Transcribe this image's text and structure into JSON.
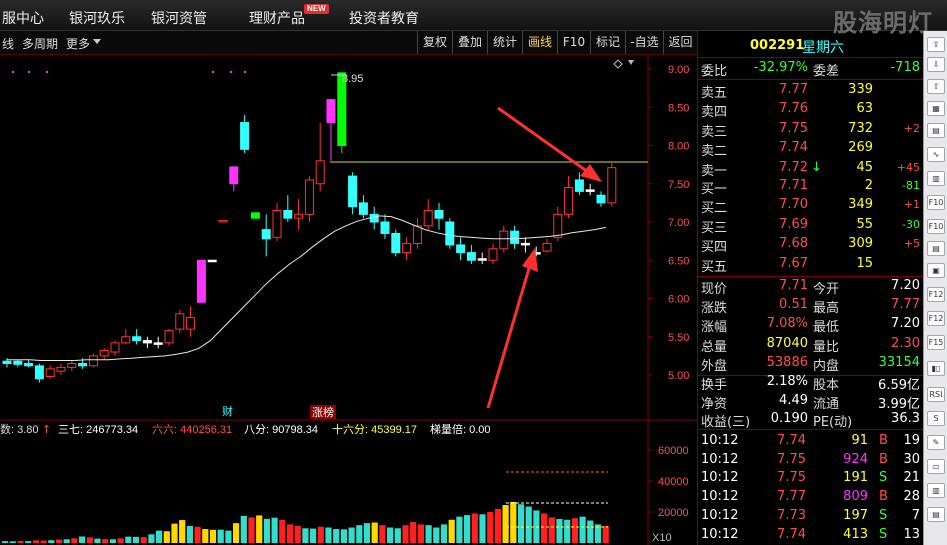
{
  "menu": {
    "items": [
      "服中心",
      "银河玖乐",
      "银河资管",
      "理财产品",
      "投资者教育"
    ],
    "new_badge": "NEW",
    "logo": "股海明灯"
  },
  "toolbar": {
    "left": [
      "线",
      "多周期",
      "更多"
    ],
    "buttons": [
      "复权",
      "叠加",
      "统计",
      "画线",
      "F10",
      "标记",
      "-自选",
      "返回"
    ],
    "active": "画线"
  },
  "quote": {
    "code": "002291",
    "name": "星期六",
    "weibi_label": "委比",
    "weibi": "-32.97%",
    "weicha_label": "委差",
    "weicha": "-718",
    "asks": [
      {
        "label": "卖五",
        "price": "7.77",
        "vol": "339",
        "chg": ""
      },
      {
        "label": "卖四",
        "price": "7.76",
        "vol": "63",
        "chg": ""
      },
      {
        "label": "卖三",
        "price": "7.75",
        "vol": "732",
        "chg": "+2"
      },
      {
        "label": "卖二",
        "price": "7.74",
        "vol": "269",
        "chg": ""
      },
      {
        "label": "卖一",
        "price": "7.72",
        "vol": "45",
        "chg": "+45",
        "arrow": "↓"
      }
    ],
    "bids": [
      {
        "label": "买一",
        "price": "7.71",
        "vol": "2",
        "chg": "-81"
      },
      {
        "label": "买二",
        "price": "7.70",
        "vol": "349",
        "chg": "+1"
      },
      {
        "label": "买三",
        "price": "7.69",
        "vol": "55",
        "chg": "-30"
      },
      {
        "label": "买四",
        "price": "7.68",
        "vol": "309",
        "chg": "+5"
      },
      {
        "label": "买五",
        "price": "7.67",
        "vol": "15",
        "chg": ""
      }
    ],
    "stats": [
      {
        "l1": "现价",
        "v1": "7.71",
        "c1": "red",
        "l2": "今开",
        "v2": "7.20",
        "c2": "wht"
      },
      {
        "l1": "涨跌",
        "v1": "0.51",
        "c1": "red",
        "l2": "最高",
        "v2": "7.77",
        "c2": "red"
      },
      {
        "l1": "涨幅",
        "v1": "7.08%",
        "c1": "red",
        "l2": "最低",
        "v2": "7.20",
        "c2": "wht"
      },
      {
        "l1": "总量",
        "v1": "87040",
        "c1": "yel",
        "l2": "量比",
        "v2": "2.30",
        "c2": "red"
      },
      {
        "l1": "外盘",
        "v1": "53886",
        "c1": "red",
        "l2": "内盘",
        "v2": "33154",
        "c2": "grn"
      }
    ],
    "stats2": [
      {
        "l1": "换手",
        "v1": "2.18%",
        "l2": "股本",
        "v2": "6.59亿"
      },
      {
        "l1": "净资",
        "v1": "4.49",
        "l2": "流通",
        "v2": "3.99亿"
      },
      {
        "l1": "收益(三)",
        "v1": "0.190",
        "l2": "PE(动)",
        "v2": "36.3"
      }
    ],
    "ticks": [
      {
        "time": "10:12",
        "price": "7.74",
        "vol": "91",
        "vc": "yel",
        "bs": "B",
        "n": "19"
      },
      {
        "time": "10:12",
        "price": "7.75",
        "vol": "924",
        "vc": "mag",
        "bs": "B",
        "n": "30"
      },
      {
        "time": "10:12",
        "price": "7.75",
        "vol": "191",
        "vc": "yel",
        "bs": "S",
        "n": "21"
      },
      {
        "time": "10:12",
        "price": "7.77",
        "vol": "809",
        "vc": "mag",
        "bs": "B",
        "n": "28"
      },
      {
        "time": "10:12",
        "price": "7.73",
        "vol": "197",
        "vc": "yel",
        "bs": "S",
        "n": "7"
      },
      {
        "time": "10:12",
        "price": "7.74",
        "vol": "413",
        "vc": "yel",
        "bs": "S",
        "n": "13"
      }
    ]
  },
  "chart_data": [
    {
      "type": "candlestick",
      "y_ticks": [
        "9.00",
        "8.50",
        "8.00",
        "7.50",
        "7.00",
        "6.50",
        "6.00",
        "5.50",
        "5.00"
      ],
      "ylim": [
        4.85,
        9.1
      ],
      "high_annotation": "8.95",
      "annotations": [
        "财",
        "涨榜"
      ],
      "ma_line": [
        5.2,
        5.2,
        5.2,
        5.19,
        5.19,
        5.19,
        5.19,
        5.2,
        5.2,
        5.2,
        5.21,
        5.22,
        5.23,
        5.24,
        5.25,
        5.27,
        5.3,
        5.35,
        5.45,
        5.6,
        5.75,
        5.9,
        6.05,
        6.2,
        6.33,
        6.45,
        6.55,
        6.67,
        6.78,
        6.88,
        6.95,
        7.01,
        7.05,
        7.08,
        7.07,
        7.02,
        6.96,
        6.9,
        6.86,
        6.83,
        6.81,
        6.8,
        6.79,
        6.78,
        6.78,
        6.78,
        6.79,
        6.8,
        6.81,
        6.83,
        6.86,
        6.88,
        6.9,
        6.93
      ],
      "candles": [
        {
          "o": 5.15,
          "h": 5.22,
          "l": 5.1,
          "c": 5.18,
          "k": "c"
        },
        {
          "o": 5.18,
          "h": 5.2,
          "l": 5.1,
          "c": 5.14,
          "k": "c"
        },
        {
          "o": 5.15,
          "h": 5.2,
          "l": 5.1,
          "c": 5.12,
          "k": "c"
        },
        {
          "o": 5.12,
          "h": 5.15,
          "l": 4.9,
          "c": 4.95,
          "k": "c"
        },
        {
          "o": 4.98,
          "h": 5.12,
          "l": 4.95,
          "c": 5.08,
          "k": "r"
        },
        {
          "o": 5.05,
          "h": 5.15,
          "l": 5.0,
          "c": 5.1,
          "k": "r"
        },
        {
          "o": 5.1,
          "h": 5.18,
          "l": 5.05,
          "c": 5.15,
          "k": "r"
        },
        {
          "o": 5.15,
          "h": 5.22,
          "l": 5.08,
          "c": 5.12,
          "k": "c"
        },
        {
          "o": 5.12,
          "h": 5.28,
          "l": 5.1,
          "c": 5.25,
          "k": "r"
        },
        {
          "o": 5.25,
          "h": 5.35,
          "l": 5.2,
          "c": 5.32,
          "k": "r"
        },
        {
          "o": 5.3,
          "h": 5.45,
          "l": 5.25,
          "c": 5.42,
          "k": "r"
        },
        {
          "o": 5.42,
          "h": 5.6,
          "l": 5.4,
          "c": 5.5,
          "k": "r"
        },
        {
          "o": 5.5,
          "h": 5.6,
          "l": 5.4,
          "c": 5.45,
          "k": "c"
        },
        {
          "o": 5.45,
          "h": 5.5,
          "l": 5.35,
          "c": 5.42,
          "k": "w"
        },
        {
          "o": 5.42,
          "h": 5.5,
          "l": 5.35,
          "c": 5.42,
          "k": "w"
        },
        {
          "o": 5.42,
          "h": 5.6,
          "l": 5.38,
          "c": 5.58,
          "k": "r"
        },
        {
          "o": 5.6,
          "h": 5.85,
          "l": 5.55,
          "c": 5.8,
          "k": "r"
        },
        {
          "o": 5.75,
          "h": 5.9,
          "l": 5.5,
          "c": 5.6,
          "k": "r"
        },
        {
          "o": 6.5,
          "h": 6.5,
          "l": 5.95,
          "c": 5.95,
          "k": "m"
        },
        {
          "o": 6.5,
          "h": 6.5,
          "l": 6.5,
          "c": 6.5,
          "k": "w"
        },
        {
          "o": 7.02,
          "h": 7.02,
          "l": 7.02,
          "c": 7.02,
          "k": "r"
        },
        {
          "o": 7.5,
          "h": 7.72,
          "l": 7.4,
          "c": 7.72,
          "k": "m"
        },
        {
          "o": 8.3,
          "h": 8.4,
          "l": 7.9,
          "c": 7.95,
          "k": "c"
        },
        {
          "o": 7.12,
          "h": 7.12,
          "l": 7.05,
          "c": 7.05,
          "k": "g"
        },
        {
          "o": 6.9,
          "h": 7.1,
          "l": 6.55,
          "c": 6.78,
          "k": "c"
        },
        {
          "o": 6.8,
          "h": 7.25,
          "l": 6.75,
          "c": 7.15,
          "k": "r"
        },
        {
          "o": 7.15,
          "h": 7.35,
          "l": 7.0,
          "c": 7.05,
          "k": "c"
        },
        {
          "o": 7.05,
          "h": 7.3,
          "l": 6.9,
          "c": 7.1,
          "k": "r"
        },
        {
          "o": 7.1,
          "h": 7.6,
          "l": 7.0,
          "c": 7.55,
          "k": "r"
        },
        {
          "o": 7.5,
          "h": 8.3,
          "l": 7.4,
          "c": 7.8,
          "k": "r"
        },
        {
          "o": 8.3,
          "h": 8.6,
          "l": 7.8,
          "c": 8.6,
          "k": "m"
        },
        {
          "o": 8.0,
          "h": 8.95,
          "l": 7.9,
          "c": 8.95,
          "k": "g"
        },
        {
          "o": 7.6,
          "h": 7.65,
          "l": 7.1,
          "c": 7.2,
          "k": "c"
        },
        {
          "o": 7.25,
          "h": 7.35,
          "l": 7.05,
          "c": 7.1,
          "k": "c"
        },
        {
          "o": 7.1,
          "h": 7.2,
          "l": 6.9,
          "c": 7.0,
          "k": "c"
        },
        {
          "o": 7.0,
          "h": 7.1,
          "l": 6.78,
          "c": 6.85,
          "k": "c"
        },
        {
          "o": 6.85,
          "h": 6.9,
          "l": 6.55,
          "c": 6.6,
          "k": "c"
        },
        {
          "o": 6.6,
          "h": 6.8,
          "l": 6.5,
          "c": 6.72,
          "k": "r"
        },
        {
          "o": 6.72,
          "h": 7.05,
          "l": 6.65,
          "c": 6.95,
          "k": "r"
        },
        {
          "o": 6.95,
          "h": 7.3,
          "l": 6.9,
          "c": 7.15,
          "k": "r"
        },
        {
          "o": 7.15,
          "h": 7.25,
          "l": 6.9,
          "c": 7.05,
          "k": "c"
        },
        {
          "o": 7.0,
          "h": 7.05,
          "l": 6.65,
          "c": 6.7,
          "k": "c"
        },
        {
          "o": 6.7,
          "h": 6.8,
          "l": 6.5,
          "c": 6.6,
          "k": "c"
        },
        {
          "o": 6.6,
          "h": 6.7,
          "l": 6.45,
          "c": 6.5,
          "k": "c"
        },
        {
          "o": 6.52,
          "h": 6.6,
          "l": 6.45,
          "c": 6.5,
          "k": "w"
        },
        {
          "o": 6.5,
          "h": 6.72,
          "l": 6.45,
          "c": 6.65,
          "k": "r"
        },
        {
          "o": 6.65,
          "h": 6.95,
          "l": 6.6,
          "c": 6.88,
          "k": "r"
        },
        {
          "o": 6.88,
          "h": 6.95,
          "l": 6.65,
          "c": 6.72,
          "k": "c"
        },
        {
          "o": 6.72,
          "h": 6.8,
          "l": 6.6,
          "c": 6.7,
          "k": "w"
        },
        {
          "o": 6.6,
          "h": 6.68,
          "l": 6.55,
          "c": 6.6,
          "k": "w"
        },
        {
          "o": 6.62,
          "h": 6.78,
          "l": 6.6,
          "c": 6.72,
          "k": "r"
        },
        {
          "o": 6.8,
          "h": 7.2,
          "l": 6.75,
          "c": 7.1,
          "k": "r"
        },
        {
          "o": 7.1,
          "h": 7.6,
          "l": 7.05,
          "c": 7.45,
          "k": "r"
        },
        {
          "o": 7.55,
          "h": 7.65,
          "l": 7.35,
          "c": 7.4,
          "k": "c"
        },
        {
          "o": 7.4,
          "h": 7.5,
          "l": 7.35,
          "c": 7.42,
          "k": "w"
        },
        {
          "o": 7.35,
          "h": 7.4,
          "l": 7.2,
          "c": 7.25,
          "k": "c"
        },
        {
          "o": 7.25,
          "h": 7.77,
          "l": 7.2,
          "c": 7.71,
          "k": "r"
        }
      ]
    },
    {
      "type": "bar",
      "title": "",
      "legend": [
        {
          "label": "数: 3.80",
          "color": "#dddddd",
          "arrow": "↑"
        },
        {
          "label": "三七: 246773.34",
          "color": "#ffffff"
        },
        {
          "label": "六六: 440256.31",
          "color": "#ff4d4d"
        },
        {
          "label": "八分: 90798.34",
          "color": "#ffffff"
        },
        {
          "label": "十六分: 45399.17",
          "color": "#ffff33"
        },
        {
          "label": "梯量倍: 0.00",
          "color": "#ffffff"
        }
      ],
      "y_ticks": [
        "60000",
        "40000",
        "20000"
      ],
      "unit": "X10",
      "ylim": [
        0,
        70000
      ],
      "values": [
        1200,
        1100,
        1300,
        1200,
        1700,
        1600,
        1800,
        2200,
        2400,
        3000,
        4200,
        3600,
        2800,
        2500,
        2400,
        3000,
        4100,
        4000,
        3800,
        5600,
        8000,
        7600,
        12500,
        14800,
        11000,
        10500,
        9000,
        8500,
        8600,
        8000,
        12800,
        17500,
        16500,
        17800,
        15600,
        16300,
        15000,
        12000,
        11000,
        9500,
        9300,
        10500,
        10000,
        9000,
        8800,
        10000,
        11500,
        12800,
        13200,
        11500,
        10000,
        9500,
        11500,
        13500,
        12000,
        11500,
        10000,
        12000,
        15000,
        17000,
        18000,
        19000,
        18500,
        20000,
        22000,
        24500,
        26500,
        25000,
        23500,
        21000,
        19000,
        16500,
        15500,
        15000,
        16000,
        17000,
        14500,
        12000,
        11000
      ],
      "colors": [
        "c",
        "c",
        "r",
        "c",
        "r",
        "r",
        "c",
        "r",
        "c",
        "r",
        "c",
        "r",
        "c",
        "r",
        "c",
        "r",
        "c",
        "c",
        "r",
        "c",
        "c",
        "y",
        "y",
        "y",
        "c",
        "r",
        "y",
        "y",
        "c",
        "c",
        "y",
        "c",
        "r",
        "y",
        "c",
        "c",
        "r",
        "r",
        "r",
        "c",
        "c",
        "r",
        "c",
        "c",
        "c",
        "c",
        "c",
        "c",
        "y",
        "r",
        "c",
        "c",
        "r",
        "r",
        "r",
        "c",
        "c",
        "c",
        "y",
        "c",
        "c",
        "r",
        "c",
        "r",
        "r",
        "y",
        "y",
        "c",
        "c",
        "c",
        "r",
        "r",
        "c",
        "c",
        "r",
        "c",
        "c",
        "c",
        "r"
      ]
    }
  ]
}
